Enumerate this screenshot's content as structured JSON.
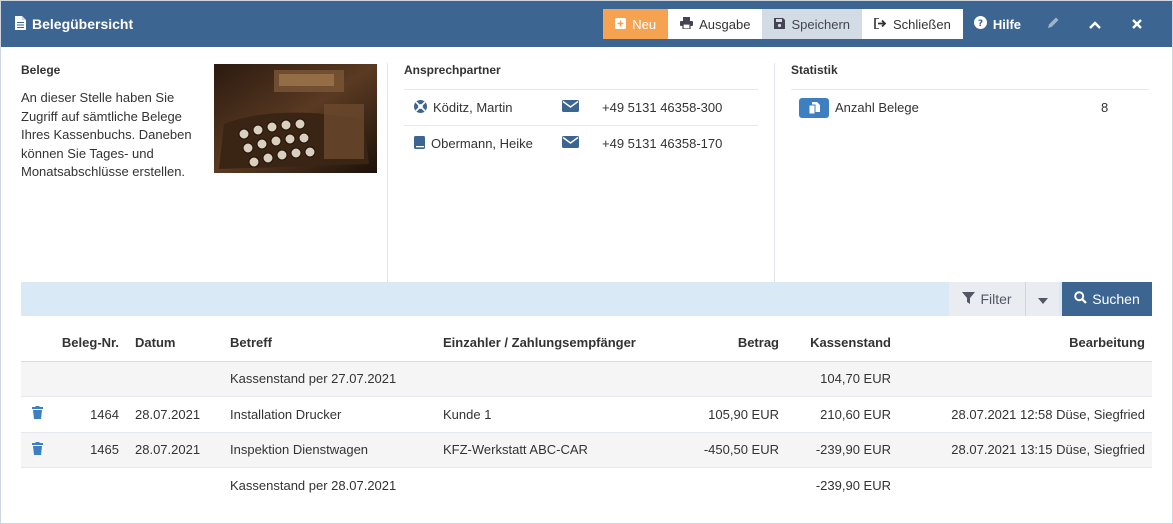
{
  "window": {
    "title": "Belegübersicht"
  },
  "toolbar": {
    "new_label": "Neu",
    "output_label": "Ausgabe",
    "save_label": "Speichern",
    "close_label": "Schließen",
    "help_label": "Hilfe"
  },
  "belege": {
    "heading": "Belege",
    "description": "An dieser Stelle haben Sie Zugriff auf sämtliche Belege Ihres Kassenbuchs. Daneben können Sie Tages- und Monatsabschlüsse erstellen."
  },
  "contacts": {
    "heading": "Ansprechpartner",
    "items": [
      {
        "name": "Köditz, Martin",
        "phone": "+49 5131 46358-300",
        "icon": "lifebuoy-icon"
      },
      {
        "name": "Obermann, Heike",
        "phone": "+49 5131 46358-170",
        "icon": "book-icon"
      }
    ]
  },
  "statistik": {
    "heading": "Statistik",
    "items": [
      {
        "label": "Anzahl Belege",
        "value": "8"
      }
    ]
  },
  "search": {
    "filter_label": "Filter",
    "search_label": "Suchen"
  },
  "table": {
    "headers": {
      "nr": "Beleg-Nr.",
      "datum": "Datum",
      "betreff": "Betreff",
      "einzahler": "Einzahler / Zahlungsempfänger",
      "betrag": "Betrag",
      "kassenstand": "Kassenstand",
      "bearbeitung": "Bearbeitung"
    },
    "rows": [
      {
        "nr": "",
        "datum": "",
        "betreff": "Kassenstand per 27.07.2021",
        "einzahler": "",
        "betrag": "",
        "kassenstand": "104,70 EUR",
        "bearbeitung": ""
      },
      {
        "nr": "1464",
        "datum": "28.07.2021",
        "betreff": "Installation Drucker",
        "einzahler": "Kunde 1",
        "betrag": "105,90 EUR",
        "kassenstand": "210,60 EUR",
        "bearbeitung": "28.07.2021 12:58 Düse, Siegfried"
      },
      {
        "nr": "1465",
        "datum": "28.07.2021",
        "betreff": "Inspektion Dienstwagen",
        "einzahler": "KFZ-Werkstatt ABC-CAR",
        "betrag": "-450,50 EUR",
        "kassenstand": "-239,90 EUR",
        "bearbeitung": "28.07.2021 13:15 Düse, Siegfried"
      },
      {
        "nr": "",
        "datum": "",
        "betreff": "Kassenstand per 28.07.2021",
        "einzahler": "",
        "betrag": "",
        "kassenstand": "-239,90 EUR",
        "bearbeitung": ""
      }
    ]
  },
  "colors": {
    "titlebar": "#3d6591",
    "accent_new": "#f5a351",
    "search_bar": "#d9eaf6",
    "icon_blue": "#3d7fc1"
  }
}
